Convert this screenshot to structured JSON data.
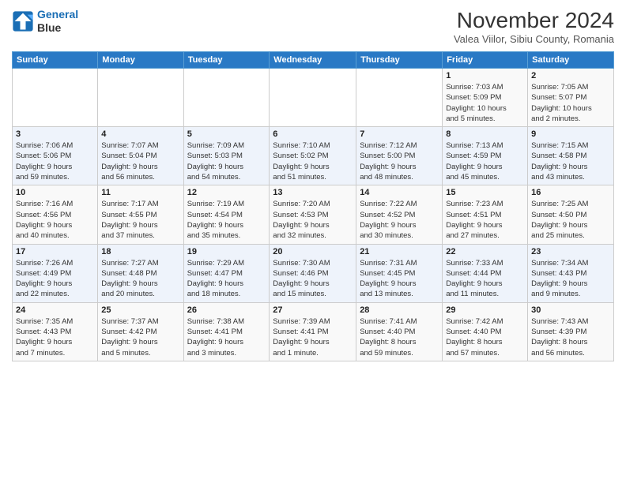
{
  "logo": {
    "line1": "General",
    "line2": "Blue"
  },
  "title": "November 2024",
  "subtitle": "Valea Viilor, Sibiu County, Romania",
  "weekdays": [
    "Sunday",
    "Monday",
    "Tuesday",
    "Wednesday",
    "Thursday",
    "Friday",
    "Saturday"
  ],
  "weeks": [
    [
      {
        "day": "",
        "info": ""
      },
      {
        "day": "",
        "info": ""
      },
      {
        "day": "",
        "info": ""
      },
      {
        "day": "",
        "info": ""
      },
      {
        "day": "",
        "info": ""
      },
      {
        "day": "1",
        "info": "Sunrise: 7:03 AM\nSunset: 5:09 PM\nDaylight: 10 hours\nand 5 minutes."
      },
      {
        "day": "2",
        "info": "Sunrise: 7:05 AM\nSunset: 5:07 PM\nDaylight: 10 hours\nand 2 minutes."
      }
    ],
    [
      {
        "day": "3",
        "info": "Sunrise: 7:06 AM\nSunset: 5:06 PM\nDaylight: 9 hours\nand 59 minutes."
      },
      {
        "day": "4",
        "info": "Sunrise: 7:07 AM\nSunset: 5:04 PM\nDaylight: 9 hours\nand 56 minutes."
      },
      {
        "day": "5",
        "info": "Sunrise: 7:09 AM\nSunset: 5:03 PM\nDaylight: 9 hours\nand 54 minutes."
      },
      {
        "day": "6",
        "info": "Sunrise: 7:10 AM\nSunset: 5:02 PM\nDaylight: 9 hours\nand 51 minutes."
      },
      {
        "day": "7",
        "info": "Sunrise: 7:12 AM\nSunset: 5:00 PM\nDaylight: 9 hours\nand 48 minutes."
      },
      {
        "day": "8",
        "info": "Sunrise: 7:13 AM\nSunset: 4:59 PM\nDaylight: 9 hours\nand 45 minutes."
      },
      {
        "day": "9",
        "info": "Sunrise: 7:15 AM\nSunset: 4:58 PM\nDaylight: 9 hours\nand 43 minutes."
      }
    ],
    [
      {
        "day": "10",
        "info": "Sunrise: 7:16 AM\nSunset: 4:56 PM\nDaylight: 9 hours\nand 40 minutes."
      },
      {
        "day": "11",
        "info": "Sunrise: 7:17 AM\nSunset: 4:55 PM\nDaylight: 9 hours\nand 37 minutes."
      },
      {
        "day": "12",
        "info": "Sunrise: 7:19 AM\nSunset: 4:54 PM\nDaylight: 9 hours\nand 35 minutes."
      },
      {
        "day": "13",
        "info": "Sunrise: 7:20 AM\nSunset: 4:53 PM\nDaylight: 9 hours\nand 32 minutes."
      },
      {
        "day": "14",
        "info": "Sunrise: 7:22 AM\nSunset: 4:52 PM\nDaylight: 9 hours\nand 30 minutes."
      },
      {
        "day": "15",
        "info": "Sunrise: 7:23 AM\nSunset: 4:51 PM\nDaylight: 9 hours\nand 27 minutes."
      },
      {
        "day": "16",
        "info": "Sunrise: 7:25 AM\nSunset: 4:50 PM\nDaylight: 9 hours\nand 25 minutes."
      }
    ],
    [
      {
        "day": "17",
        "info": "Sunrise: 7:26 AM\nSunset: 4:49 PM\nDaylight: 9 hours\nand 22 minutes."
      },
      {
        "day": "18",
        "info": "Sunrise: 7:27 AM\nSunset: 4:48 PM\nDaylight: 9 hours\nand 20 minutes."
      },
      {
        "day": "19",
        "info": "Sunrise: 7:29 AM\nSunset: 4:47 PM\nDaylight: 9 hours\nand 18 minutes."
      },
      {
        "day": "20",
        "info": "Sunrise: 7:30 AM\nSunset: 4:46 PM\nDaylight: 9 hours\nand 15 minutes."
      },
      {
        "day": "21",
        "info": "Sunrise: 7:31 AM\nSunset: 4:45 PM\nDaylight: 9 hours\nand 13 minutes."
      },
      {
        "day": "22",
        "info": "Sunrise: 7:33 AM\nSunset: 4:44 PM\nDaylight: 9 hours\nand 11 minutes."
      },
      {
        "day": "23",
        "info": "Sunrise: 7:34 AM\nSunset: 4:43 PM\nDaylight: 9 hours\nand 9 minutes."
      }
    ],
    [
      {
        "day": "24",
        "info": "Sunrise: 7:35 AM\nSunset: 4:43 PM\nDaylight: 9 hours\nand 7 minutes."
      },
      {
        "day": "25",
        "info": "Sunrise: 7:37 AM\nSunset: 4:42 PM\nDaylight: 9 hours\nand 5 minutes."
      },
      {
        "day": "26",
        "info": "Sunrise: 7:38 AM\nSunset: 4:41 PM\nDaylight: 9 hours\nand 3 minutes."
      },
      {
        "day": "27",
        "info": "Sunrise: 7:39 AM\nSunset: 4:41 PM\nDaylight: 9 hours\nand 1 minute."
      },
      {
        "day": "28",
        "info": "Sunrise: 7:41 AM\nSunset: 4:40 PM\nDaylight: 8 hours\nand 59 minutes."
      },
      {
        "day": "29",
        "info": "Sunrise: 7:42 AM\nSunset: 4:40 PM\nDaylight: 8 hours\nand 57 minutes."
      },
      {
        "day": "30",
        "info": "Sunrise: 7:43 AM\nSunset: 4:39 PM\nDaylight: 8 hours\nand 56 minutes."
      }
    ]
  ]
}
